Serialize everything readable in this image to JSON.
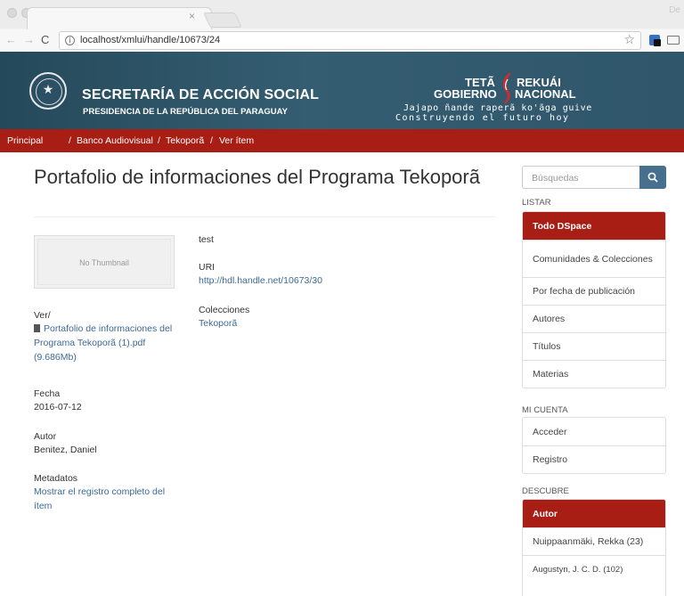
{
  "browser": {
    "url": "localhost/xmlui/handle/10673/24",
    "user_label": "De"
  },
  "header": {
    "org_title": "SECRETARÍA DE ACCIÓN SOCIAL",
    "org_subtitle": "PRESIDENCIA DE LA REPÚBLICA DEL PARAGUAY",
    "brand_line1_left": "TETÃ",
    "brand_line1_right": "REKUÁI",
    "brand_line2_left": "GOBIERNO",
    "brand_line2_right": "NACIONAL",
    "motto_line1": "Jajapo ñande raperã ko'ãga guive",
    "motto_line2": "Construyendo el futuro hoy"
  },
  "breadcrumb": {
    "items": [
      "Principal",
      "Banco Audiovisual",
      "Tekoporã",
      "Ver ítem"
    ],
    "separator": "/"
  },
  "item": {
    "title": "Portafolio de informaciones del Programa Tekoporã",
    "thumbnail_label": "No Thumbnail",
    "view_label": "Ver/",
    "file_link": "Portafolio de informaciones del Programa Tekoporã (1).pdf (9.686Mb)",
    "date_label": "Fecha",
    "date_value": "2016-07-12",
    "author_label": "Autor",
    "author_value": "Benitez, Daniel",
    "metadata_label": "Metadatos",
    "metadata_link": "Mostrar el registro completo del ítem",
    "abstract": "test",
    "uri_label": "URI",
    "uri_value": "http://hdl.handle.net/10673/30",
    "collections_label": "Colecciones",
    "collections_value": "Tekoporã"
  },
  "sidebar": {
    "search_placeholder": "Búsquedas",
    "listar_heading": "LISTAR",
    "listar_items": [
      "Todo DSpace",
      "Comunidades & Colecciones",
      "Por fecha de publicación",
      "Autores",
      "Títulos",
      "Materias"
    ],
    "account_heading": "MI CUENTA",
    "account_items": [
      "Acceder",
      "Registro"
    ],
    "discover_heading": "DESCUBRE",
    "discover_items": [
      "Autor",
      "Nuippaanmäki, Rekka (23)",
      "Augustyn, J. C. D. (102)"
    ]
  },
  "colors": {
    "header_bg": "#2f566b",
    "breadcrumb_bg": "#a81d14",
    "active_item_bg": "#a81d14",
    "link": "#3c6a95",
    "search_button": "#476f8e"
  }
}
